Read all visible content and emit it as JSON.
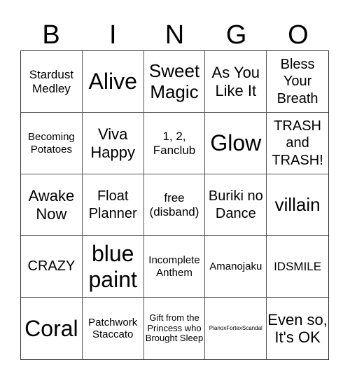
{
  "title": [
    "B",
    "I",
    "N",
    "G",
    "O"
  ],
  "cells": [
    {
      "text": "Stardust Medley",
      "size": "s-s"
    },
    {
      "text": "Alive",
      "size": "s-xl"
    },
    {
      "text": "Sweet Magic",
      "size": "s-l"
    },
    {
      "text": "As You Like It",
      "size": "s-m"
    },
    {
      "text": "Bless Your Breath",
      "size": "s-n"
    },
    {
      "text": "Becoming Potatoes",
      "size": "s-xs"
    },
    {
      "text": "Viva Happy",
      "size": "s-m"
    },
    {
      "text": "1, 2, Fanclub",
      "size": "s-s"
    },
    {
      "text": "Glow",
      "size": "s-xl"
    },
    {
      "text": "TRASH and TRASH!",
      "size": "s-n"
    },
    {
      "text": "Awake Now",
      "size": "s-m"
    },
    {
      "text": "Float Planner",
      "size": "s-n"
    },
    {
      "text": "free (disband)",
      "size": "s-s"
    },
    {
      "text": "Buriki no Dance",
      "size": "s-n"
    },
    {
      "text": "villain",
      "size": "s-l"
    },
    {
      "text": "CRAZY",
      "size": "s-n"
    },
    {
      "text": "blue paint",
      "size": "s-xl"
    },
    {
      "text": "Incomplete Anthem",
      "size": "s-xs"
    },
    {
      "text": "Amanojaku",
      "size": "s-xs"
    },
    {
      "text": "IDSMILE",
      "size": "s-s"
    },
    {
      "text": "Coral",
      "size": "s-xl"
    },
    {
      "text": "Patchwork Staccato",
      "size": "s-xs"
    },
    {
      "text": "Gift from the Princess who Brought Sleep",
      "size": "s-xxs"
    },
    {
      "text": "PianoxFortexScandal",
      "size": "s-tiny"
    },
    {
      "text": "Even so, It's OK",
      "size": "s-m"
    }
  ]
}
